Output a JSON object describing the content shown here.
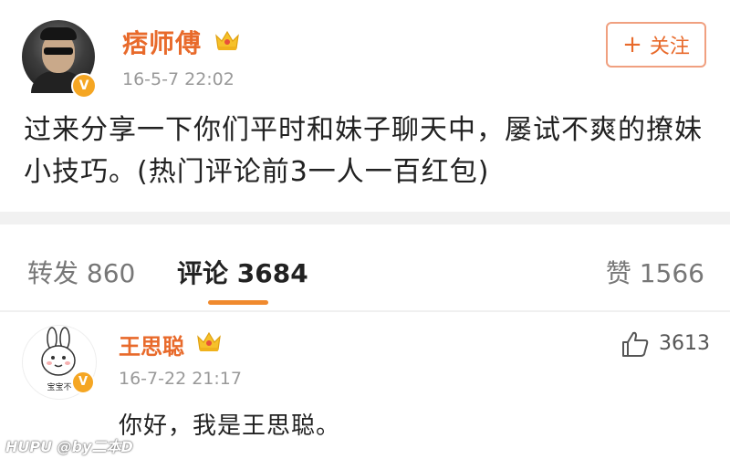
{
  "post": {
    "author": "痞师傅",
    "time": "16-5-7 22:02",
    "follow_label": "关注",
    "follow_plus": "+",
    "verified_badge": "V",
    "text": "过来分享一下你们平时和妹子聊天中，屡试不爽的撩妹小技巧。(热门评论前3一人一百红包)"
  },
  "tabs": {
    "repost": "转发 860",
    "comment": "评论 3684",
    "like": "赞 1566"
  },
  "comment": {
    "author": "王思聪",
    "time": "16-7-22 21:17",
    "text": "你好，我是王思聪。",
    "likes": "3613",
    "avatar_caption": "宝宝不",
    "verified_badge": "V"
  },
  "watermark": "HUPU @by二本D",
  "icons": {
    "follow": "plus-icon",
    "crown": "crown-icon",
    "like": "thumbs-up-icon",
    "verified": "verified-v-icon"
  },
  "colors": {
    "accent": "#e86a2b",
    "badge": "#f5a623",
    "tab_underline": "#f08a2e"
  }
}
